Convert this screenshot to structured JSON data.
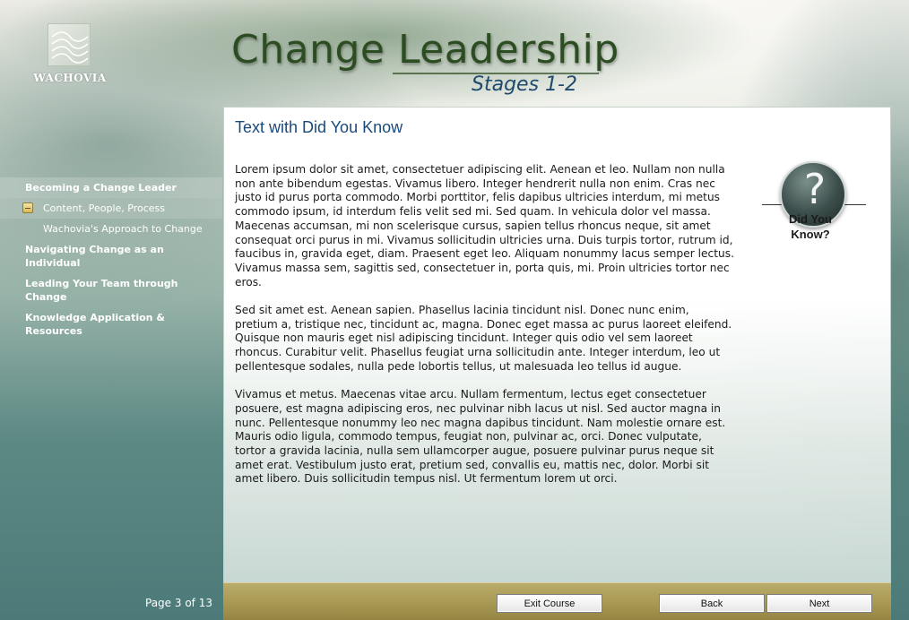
{
  "brand": {
    "logo_text": "WACHOVIA"
  },
  "header": {
    "title": "Change Leadership",
    "subtitle": "Stages 1-2"
  },
  "sidebar": {
    "items": [
      {
        "label": "Becoming a Change Leader",
        "level": "section",
        "active": true
      },
      {
        "label": "Content, People, Process",
        "level": "sub",
        "current": true
      },
      {
        "label": "Wachovia's Approach to Change",
        "level": "sub"
      },
      {
        "label": "Navigating Change as an Individual",
        "level": "section"
      },
      {
        "label": "Leading Your Team through Change",
        "level": "section"
      },
      {
        "label": "Knowledge Application & Resources",
        "level": "section"
      }
    ],
    "page_indicator": "Page 3 of 13"
  },
  "main": {
    "heading": "Text with Did You Know",
    "paragraphs": [
      "Lorem ipsum dolor sit amet, consectetuer adipiscing elit. Aenean et leo. Nullam non nulla non ante bibendum egestas. Vivamus libero. Integer hendrerit nulla non enim. Cras nec justo id purus porta commodo. Morbi porttitor, felis dapibus ultricies interdum, mi metus commodo ipsum, id interdum felis velit sed mi. Sed quam. In vehicula dolor vel massa. Maecenas accumsan, mi non scelerisque cursus, sapien tellus rhoncus neque, sit amet consequat orci purus in mi. Vivamus sollicitudin ultricies urna. Duis turpis tortor, rutrum id, faucibus in, gravida eget, diam. Praesent eget leo. Aliquam nonummy lacus semper lectus. Vivamus massa sem, sagittis sed, consectetuer in, porta quis, mi. Proin ultricies tortor nec eros.",
      "Sed sit amet est. Aenean sapien. Phasellus lacinia tincidunt nisl. Donec nunc enim, pretium a, tristique nec, tincidunt ac, magna. Donec eget massa ac purus laoreet eleifend. Quisque non mauris eget nisl adipiscing tincidunt. Integer quis odio vel sem laoreet rhoncus. Curabitur velit. Phasellus feugiat urna sollicitudin ante. Integer interdum, leo ut pellentesque sodales, nulla pede lobortis tellus, ut malesuada leo tellus id augue.",
      "Vivamus et metus. Maecenas vitae arcu. Nullam fermentum, lectus eget consectetuer posuere, est magna adipiscing eros, nec pulvinar nibh lacus ut nisl. Sed auctor magna in nunc. Pellentesque nonummy leo nec magna dapibus tincidunt. Nam molestie ornare est. Mauris odio ligula, commodo tempus, feugiat non, pulvinar ac, orci. Donec vulputate, tortor a gravida lacinia, nulla sem ullamcorper augue, posuere pulvinar purus neque sit amet erat. Vestibulum justo erat, pretium sed, convallis eu, mattis nec, dolor. Morbi sit amet libero. Duis sollicitudin tempus nisl. Ut fermentum lorem ut orci."
    ],
    "did_you_know": {
      "symbol": "?",
      "label_line1": "Did You",
      "label_line2": "Know?"
    }
  },
  "footer": {
    "exit_label": "Exit Course",
    "back_label": "Back",
    "next_label": "Next"
  }
}
